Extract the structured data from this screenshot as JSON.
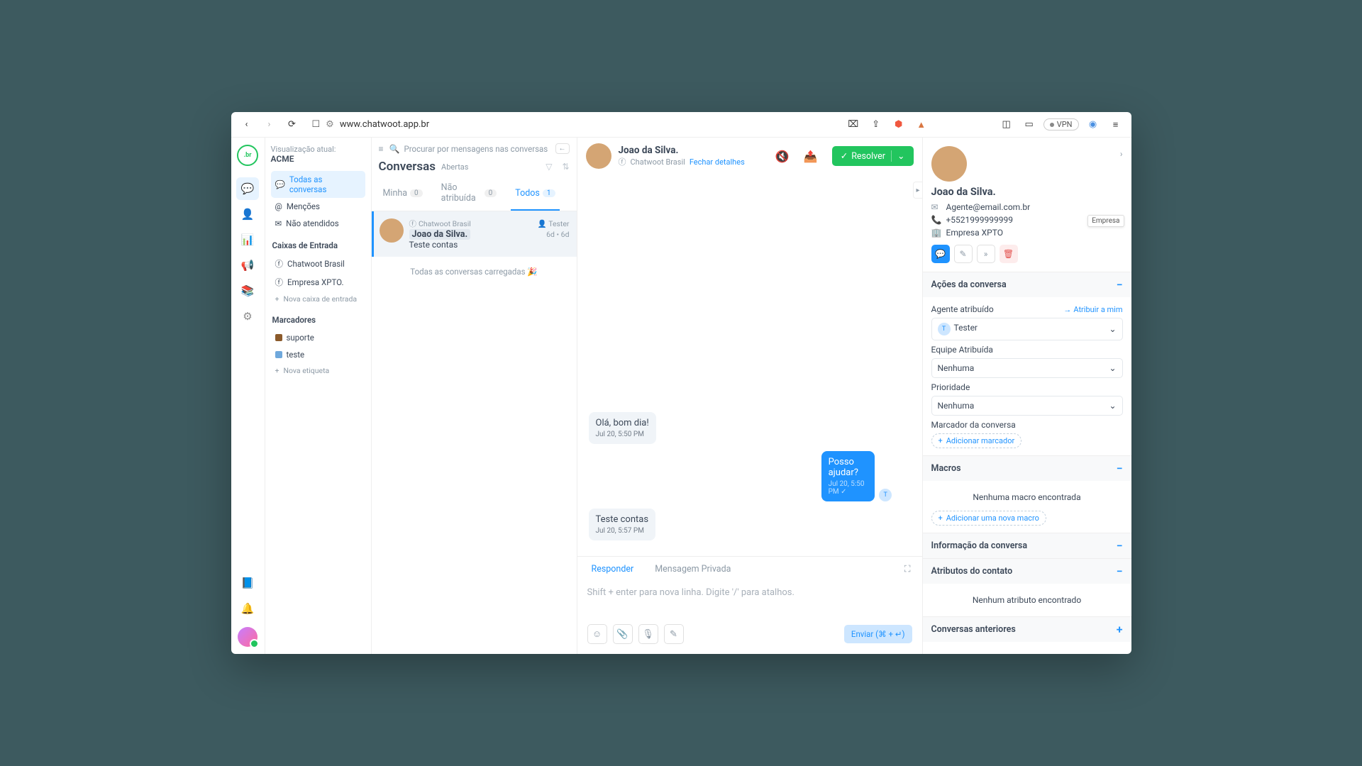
{
  "browser": {
    "url": "www.chatwoot.app.br",
    "vpn": "VPN"
  },
  "rail": {
    "logo": ".br"
  },
  "sidenav": {
    "account_label": "Visualização atual:",
    "account_name": "ACME",
    "items": {
      "all": "Todas as conversas",
      "mentions": "Menções",
      "unattended": "Não atendidos"
    },
    "inbox_header": "Caixas de Entrada",
    "inboxes": [
      "Chatwoot Brasil",
      "Empresa XPTO."
    ],
    "new_inbox": "Nova caixa de entrada",
    "labels_header": "Marcadores",
    "labels": [
      {
        "name": "suporte",
        "color": "#8b5a2b"
      },
      {
        "name": "teste",
        "color": "#6fa8dc"
      }
    ],
    "new_label": "Nova etiqueta"
  },
  "convlist": {
    "search_placeholder": "Procurar por mensagens nas conversas",
    "title": "Conversas",
    "open_label": "Abertas",
    "tabs": {
      "mine": "Minha",
      "mine_count": "0",
      "unassigned": "Não atribuída",
      "unassigned_count": "0",
      "all": "Todos",
      "all_count": "1"
    },
    "item": {
      "source": "Chatwoot Brasil",
      "tester": "Tester",
      "name": "Joao da Silva.",
      "time": "6d • 6d",
      "snippet": "Teste contas"
    },
    "loaded": "Todas as conversas carregadas 🎉"
  },
  "chat": {
    "name": "Joao da Silva.",
    "source": "Chatwoot Brasil",
    "close_details": "Fechar detalhes",
    "resolve": "Resolver",
    "messages": {
      "m1": {
        "text": "Olá, bom dia!",
        "ts": "Jul 20, 5:50 PM"
      },
      "m2": {
        "text": "Posso ajudar?",
        "ts": "Jul 20, 5:50 PM"
      },
      "m3": {
        "text": "Teste contas",
        "ts": "Jul 20, 5:57 PM"
      }
    },
    "reply_tab": "Responder",
    "private_tab": "Mensagem Privada",
    "placeholder": "Shift + enter para nova linha. Digite '/' para atalhos.",
    "send": "Enviar (⌘ + ↵)"
  },
  "details": {
    "name": "Joao da Silva.",
    "email": "Agente@email.com.br",
    "phone": "+5521999999999",
    "company": "Empresa XPTO",
    "tooltip": "Empresa",
    "sections": {
      "actions": "Ações da conversa",
      "macros": "Macros",
      "info": "Informação da conversa",
      "attrs": "Atributos do contato",
      "prev": "Conversas anteriores"
    },
    "fields": {
      "agent_label": "Agente atribuído",
      "assign_me": "Atribuir a mim",
      "agent_value": "Tester",
      "team_label": "Equipe Atribuída",
      "team_value": "Nenhuma",
      "priority_label": "Prioridade",
      "priority_value": "Nenhuma",
      "conv_label_label": "Marcador da conversa",
      "add_label": "Adicionar marcador"
    },
    "macros_empty": "Nenhuma macro encontrada",
    "macros_add": "Adicionar uma nova macro",
    "attrs_empty": "Nenhum atributo encontrado"
  }
}
